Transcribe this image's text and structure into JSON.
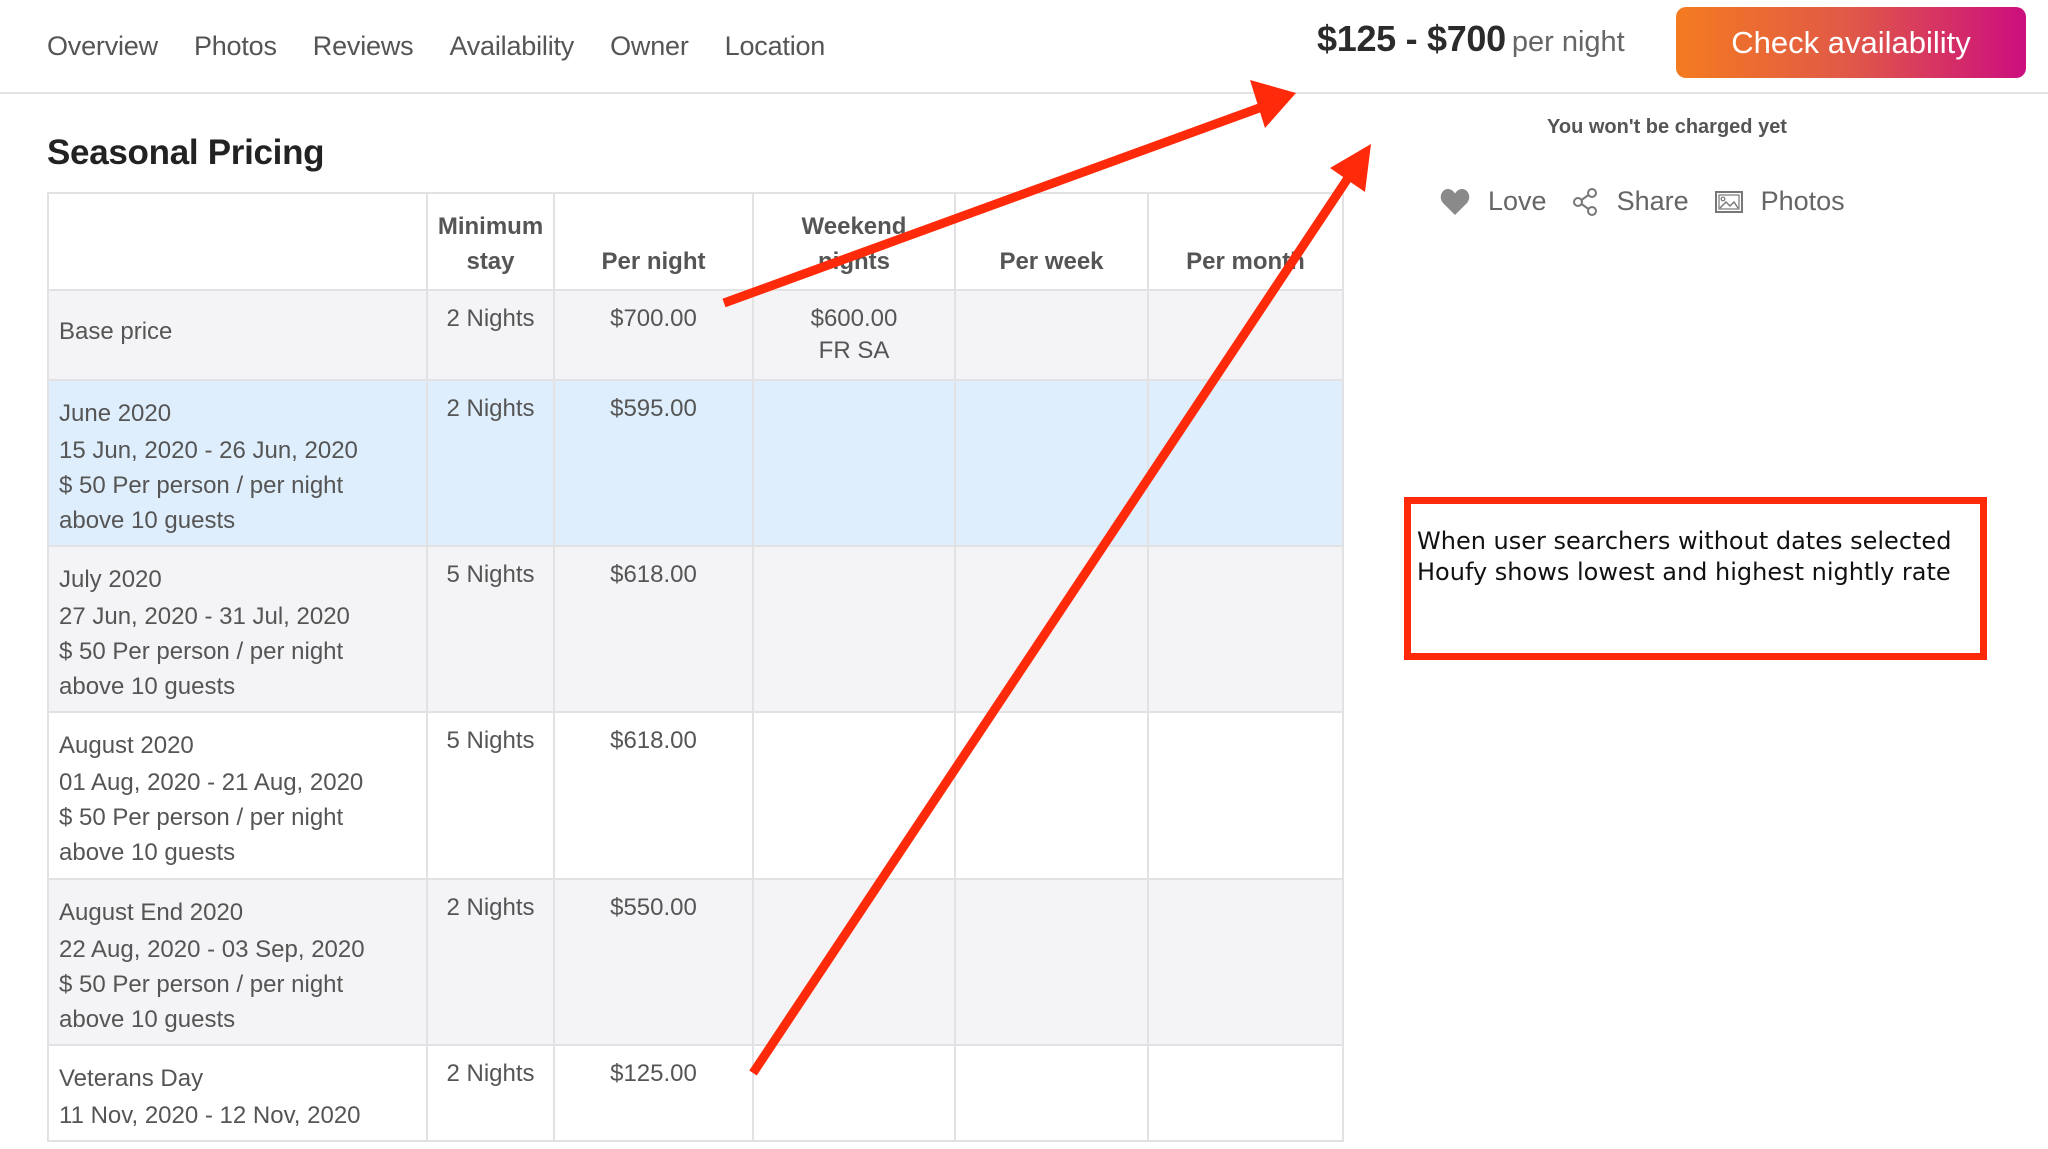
{
  "nav": {
    "items": [
      "Overview",
      "Photos",
      "Reviews",
      "Availability",
      "Owner",
      "Location"
    ]
  },
  "header": {
    "price_range": "$125 - $700",
    "price_unit": "per night",
    "cta_label": "Check availability",
    "cta_gradient": [
      "#F47B20",
      "#CC0E7E"
    ]
  },
  "booking": {
    "note": "You won't be charged yet",
    "actions": [
      {
        "icon": "heart-icon",
        "label": "Love"
      },
      {
        "icon": "share-icon",
        "label": "Share"
      },
      {
        "icon": "image-icon",
        "label": "Photos"
      }
    ]
  },
  "seasonal": {
    "title": "Seasonal Pricing",
    "columns": {
      "label": "",
      "min_stay_1": "Minimum",
      "min_stay_2": "stay",
      "per_night": "Per night",
      "weekend_1": "Weekend",
      "weekend_2": "nights",
      "per_week": "Per week",
      "per_month": "Per month"
    },
    "rows": [
      {
        "title": "Base price",
        "dates": "",
        "extra1": "",
        "extra2": "",
        "min_stay": "2 Nights",
        "per_night": "$700.00",
        "weekend": "$600.00",
        "weekend_days": "FR SA",
        "per_week": "",
        "per_month": "",
        "highlighted": false
      },
      {
        "title": "June 2020",
        "dates": "15 Jun, 2020 - 26 Jun, 2020",
        "extra1": "$ 50 Per person / per night",
        "extra2": "above 10 guests",
        "min_stay": "2 Nights",
        "per_night": "$595.00",
        "weekend": "",
        "weekend_days": "",
        "per_week": "",
        "per_month": "",
        "highlighted": true
      },
      {
        "title": "July 2020",
        "dates": "27 Jun, 2020 - 31 Jul, 2020",
        "extra1": "$ 50 Per person / per night",
        "extra2": "above 10 guests",
        "min_stay": "5 Nights",
        "per_night": "$618.00",
        "weekend": "",
        "weekend_days": "",
        "per_week": "",
        "per_month": "",
        "highlighted": false
      },
      {
        "title": "August 2020",
        "dates": "01 Aug, 2020 - 21 Aug, 2020",
        "extra1": "$ 50 Per person / per night",
        "extra2": "above 10 guests",
        "min_stay": "5 Nights",
        "per_night": "$618.00",
        "weekend": "",
        "weekend_days": "",
        "per_week": "",
        "per_month": "",
        "highlighted": false
      },
      {
        "title": "August End 2020",
        "dates": "22 Aug, 2020 - 03 Sep, 2020",
        "extra1": "$ 50 Per person / per night",
        "extra2": "above 10 guests",
        "min_stay": "2 Nights",
        "per_night": "$550.00",
        "weekend": "",
        "weekend_days": "",
        "per_week": "",
        "per_month": "",
        "highlighted": false
      },
      {
        "title": "Veterans Day",
        "dates": "11 Nov, 2020 - 12 Nov, 2020",
        "extra1": "",
        "extra2": "",
        "min_stay": "2 Nights",
        "per_night": "$125.00",
        "weekend": "",
        "weekend_days": "",
        "per_week": "",
        "per_month": "",
        "highlighted": false
      }
    ]
  },
  "annotation": {
    "text": "When user searchers without dates selected Houfy shows lowest and highest nightly rate",
    "color": "#FF2A0A"
  }
}
